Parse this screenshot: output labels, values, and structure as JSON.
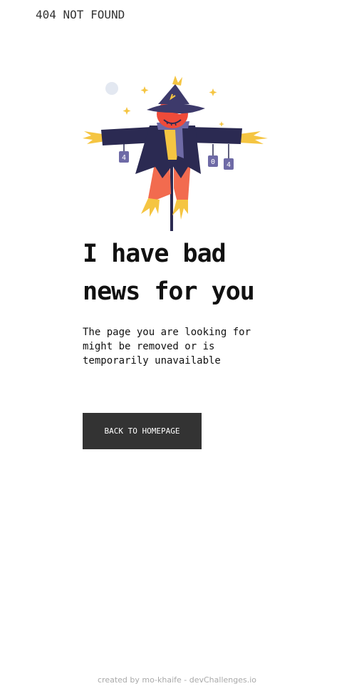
{
  "header": {
    "brand": "404 NOT FOUND"
  },
  "illustration": {
    "icon": "scarecrow-icon",
    "sign_text_left": "4",
    "sign_text_mid": "0",
    "sign_text_right": "4"
  },
  "main": {
    "headline_line1": "I have bad",
    "headline_line2": "news for you",
    "message_line1": "The page you are looking for",
    "message_line2": "might be removed or is",
    "message_line3": "temporarily unavailable",
    "button_label": "BACK TO HOMEPAGE"
  },
  "footer": {
    "credit": "created by mo-khaife - devChallenges.io"
  },
  "colors": {
    "button_bg": "#333333",
    "hat": "#3d3a6b",
    "coat": "#2b2a52",
    "face": "#ef4b3a",
    "straw": "#f5c542",
    "pants": "#f26b4f",
    "sign": "#6e6aa6"
  }
}
